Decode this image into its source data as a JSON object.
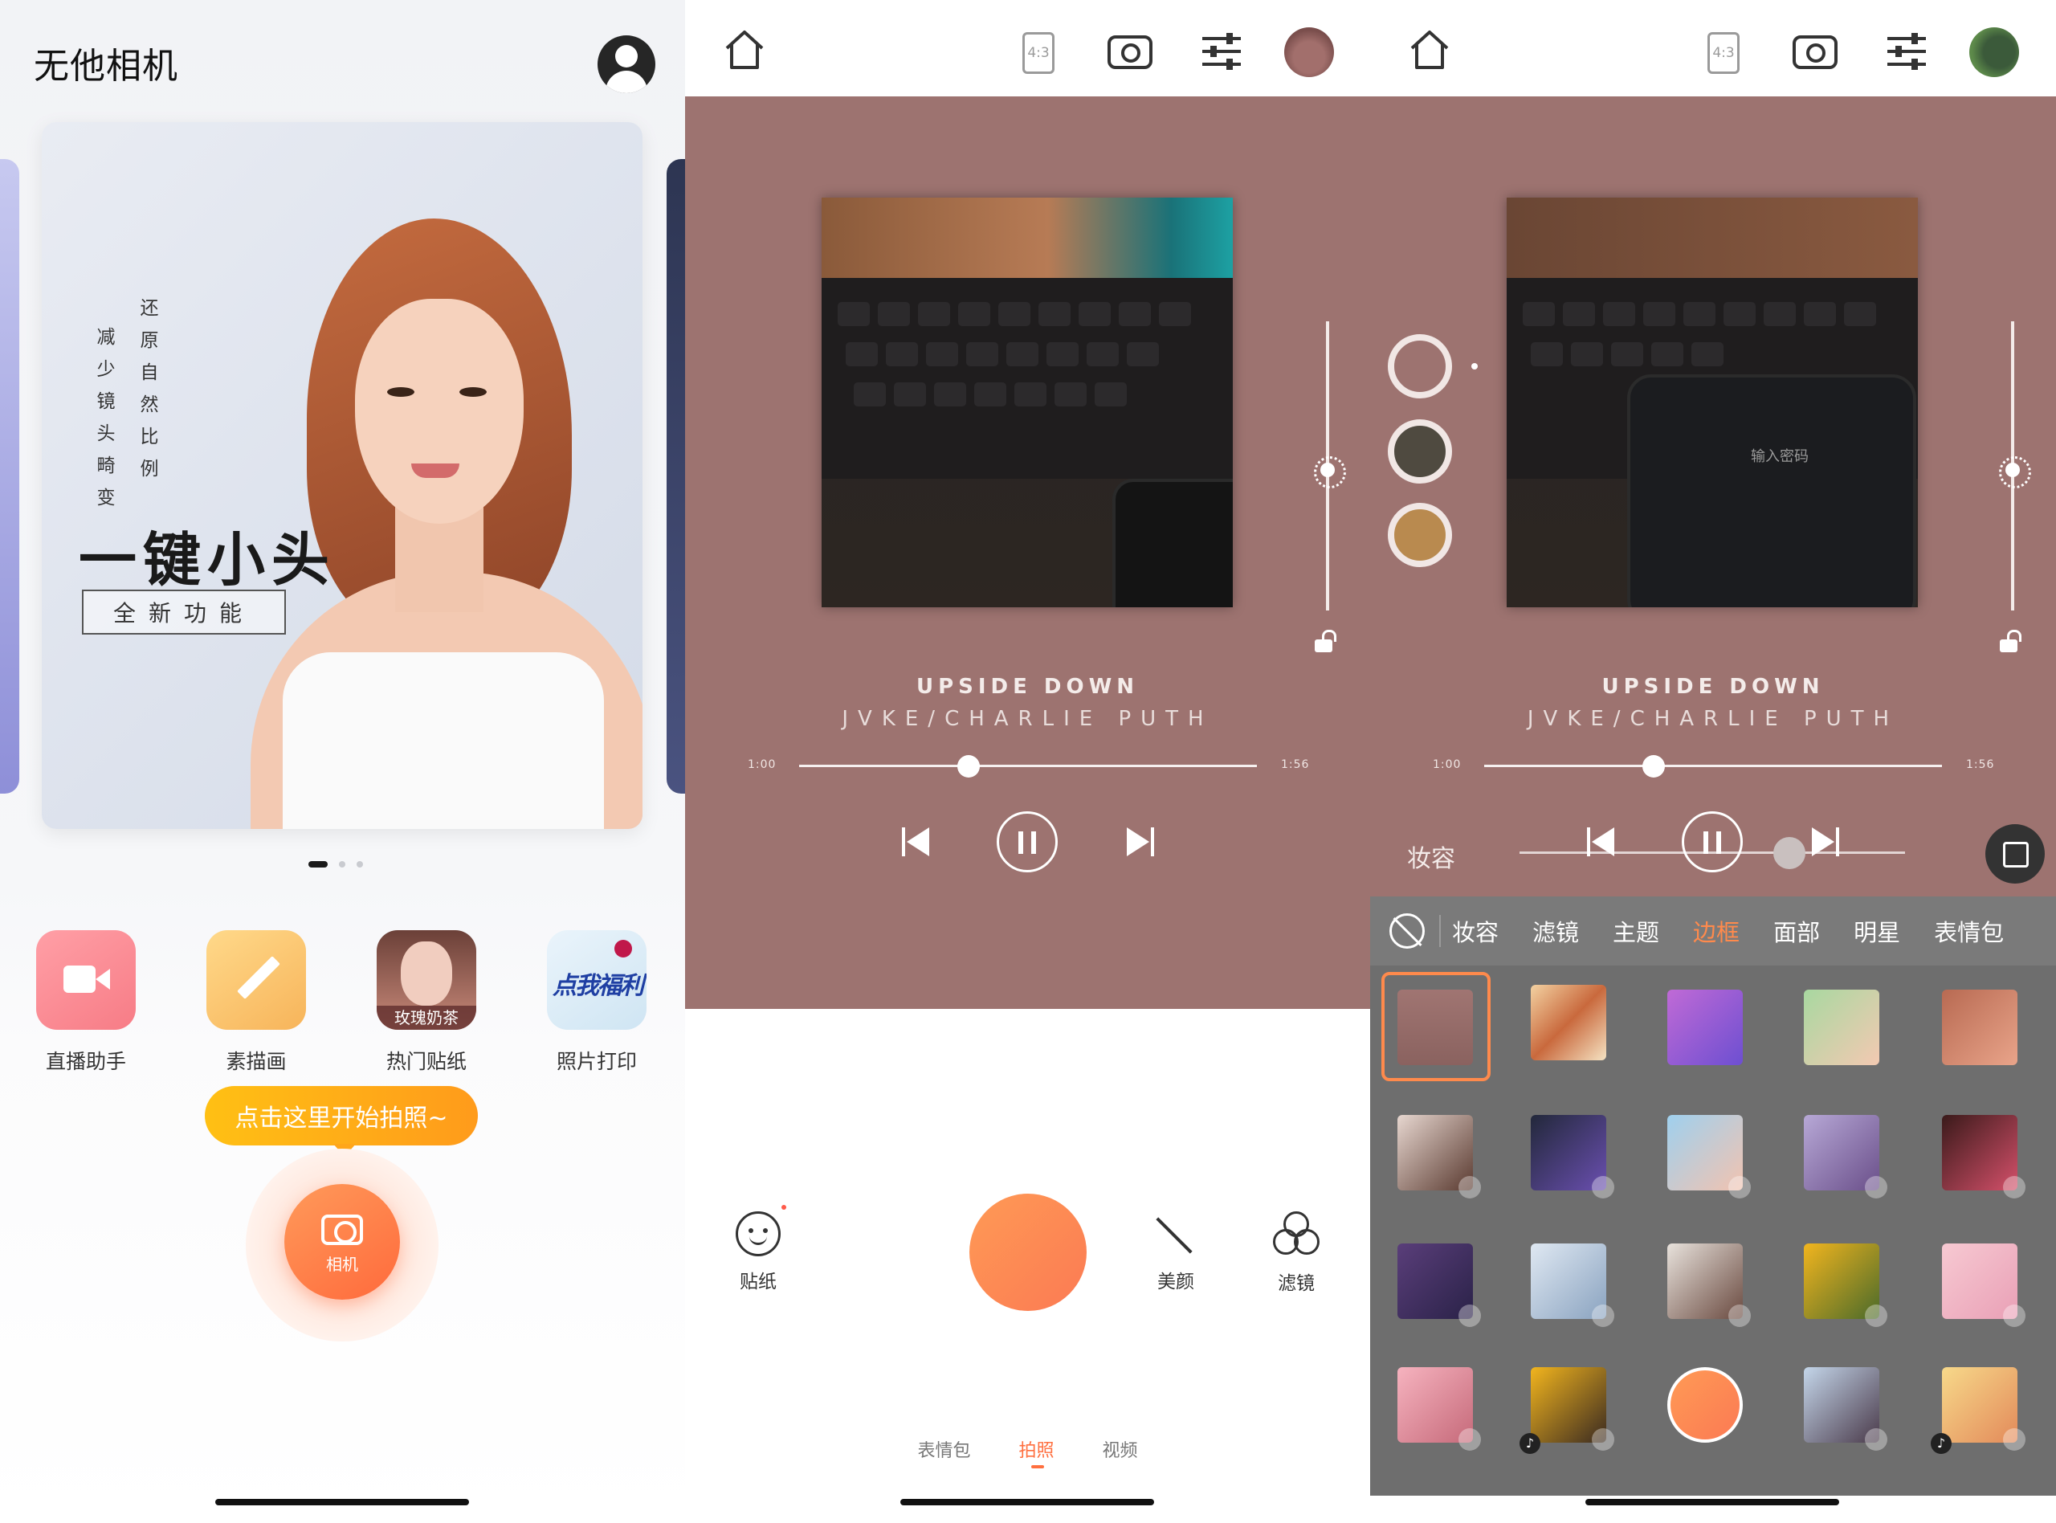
{
  "home": {
    "app_title": "无他相机",
    "banner": {
      "col1": [
        "减",
        "少",
        "镜",
        "头",
        "畸",
        "变"
      ],
      "col2": [
        "还",
        "原",
        "自",
        "然",
        "比",
        "例"
      ],
      "title": "一键小头",
      "badge": "全新功能"
    },
    "tools": [
      {
        "label": "直播助手",
        "icon": "video-icon"
      },
      {
        "label": "素描画",
        "icon": "pencil-icon"
      },
      {
        "label": "热门贴纸",
        "icon": "sticker-thumb",
        "caption": "玫瑰奶茶"
      },
      {
        "label": "照片打印",
        "icon": "print-promo-thumb",
        "caption": "点我福利"
      }
    ],
    "tip": "点击这里开始拍照~",
    "camera_label": "相机"
  },
  "camera": {
    "ratio": "4:3",
    "song_title": "UPSIDE DOWN",
    "song_artist": "JVKE/CHARLIE PUTH",
    "time_start": "1:00",
    "time_end": "1:56",
    "progress": 0.37,
    "buttons": {
      "sticker": "贴纸",
      "beauty": "美颜",
      "filter": "滤镜"
    },
    "modes": [
      "表情包",
      "拍照",
      "视频"
    ],
    "active_mode": "拍照"
  },
  "frames": {
    "ratio": "4:3",
    "song_title": "UPSIDE DOWN",
    "song_artist": "JVKE/CHARLIE PUTH",
    "time_start": "1:00",
    "time_end": "1:56",
    "progress": 0.37,
    "makeup_label": "妆容",
    "makeup_level": 0.7,
    "categories": [
      "妆容",
      "滤镜",
      "主题",
      "边框",
      "面部",
      "明星",
      "表情包"
    ],
    "active_category": "边框",
    "phone_screen_text": "输入密码",
    "colors": {
      "accent": "#ff8a4c",
      "player_bg": "#9d7370",
      "shutter": "#fb7a54",
      "tip": "#ffa61a"
    }
  }
}
